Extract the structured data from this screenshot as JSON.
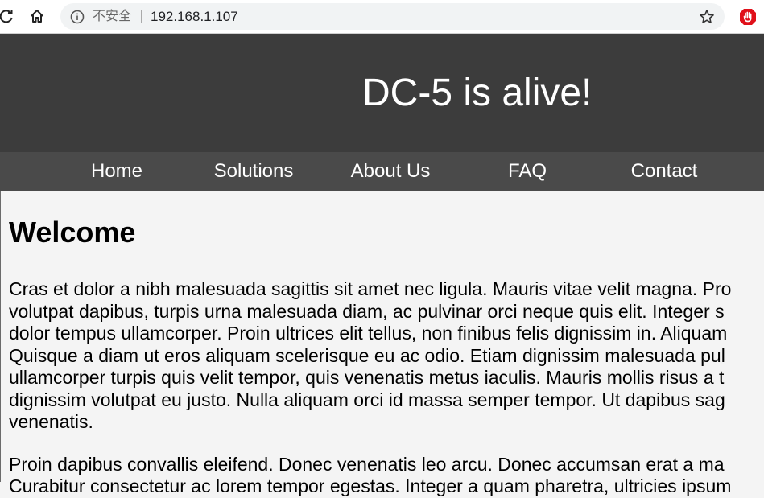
{
  "browser": {
    "security_label": "不安全",
    "url": "192.168.1.107"
  },
  "site": {
    "title": "DC-5 is alive!"
  },
  "nav": {
    "items": [
      "Home",
      "Solutions",
      "About Us",
      "FAQ",
      "Contact"
    ]
  },
  "main": {
    "heading": "Welcome",
    "paragraph1": "Cras et dolor a nibh malesuada sagittis sit amet nec ligula. Mauris vitae velit magna. Pro\nvolutpat dapibus, turpis urna malesuada diam, ac pulvinar orci neque quis elit. Integer s\ndolor tempus ullamcorper. Proin ultrices elit tellus, non finibus felis dignissim in. Aliquam\nQuisque a diam ut eros aliquam scelerisque eu ac odio. Etiam dignissim malesuada pul\nullamcorper turpis quis velit tempor, quis venenatis metus iaculis. Mauris mollis risus a t\ndignissim volutpat eu justo. Nulla aliquam orci id massa semper tempor. Ut dapibus sag\nvenenatis.",
    "paragraph2": "Proin dapibus convallis eleifend. Donec venenatis leo arcu. Donec accumsan erat a ma\nCurabitur consectetur ac lorem tempor egestas. Integer a quam pharetra, ultricies ipsum"
  },
  "colors": {
    "header_bg": "#3c3c3c",
    "nav_bg": "#4a4a4a",
    "page_bg": "#f4f4f4",
    "ext_red": "#e0101a"
  },
  "icons": [
    "reload-icon",
    "home-icon",
    "info-icon",
    "star-icon",
    "extension-icon"
  ]
}
